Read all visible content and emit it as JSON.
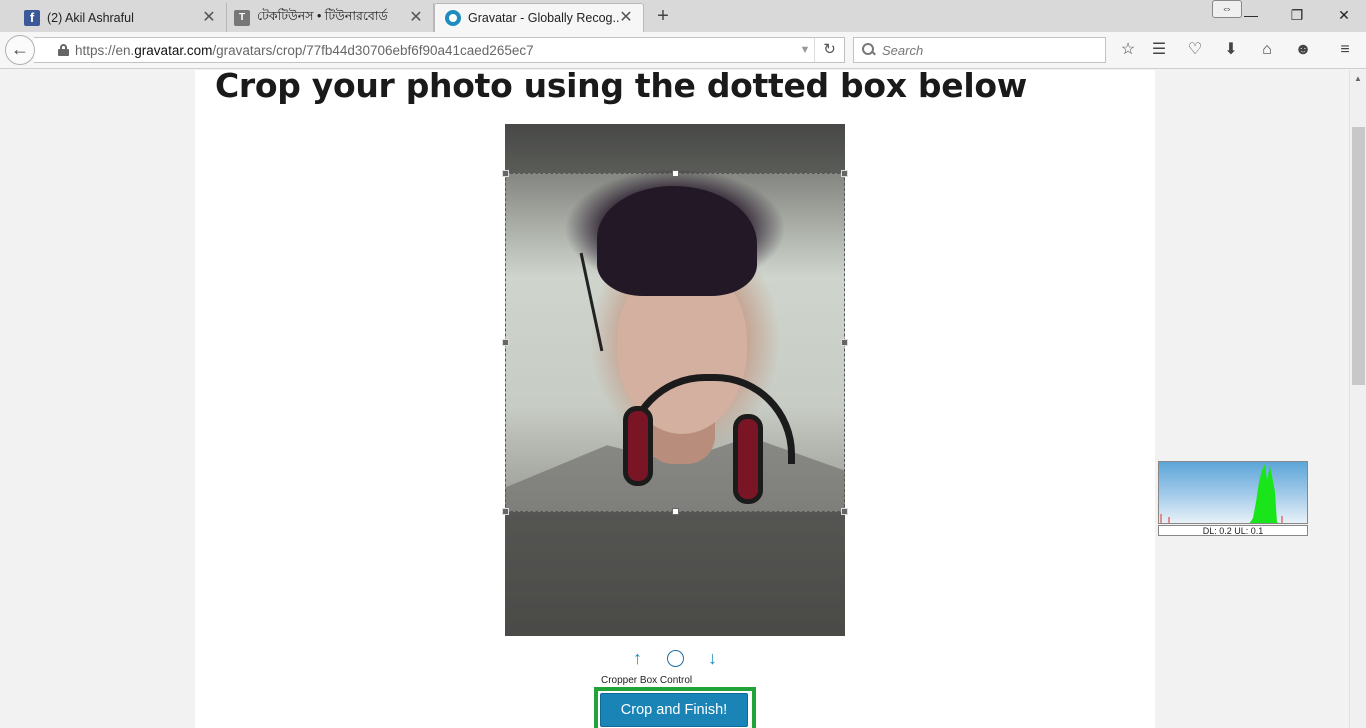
{
  "browser": {
    "tabs": [
      {
        "title": "(2) Akil Ashraful",
        "favicon": "facebook-icon"
      },
      {
        "title": "টেকটিউনস • টিউনারবোর্ড",
        "favicon": "techtunes-icon"
      },
      {
        "title": "Gravatar - Globally Recog...",
        "favicon": "gravatar-icon"
      }
    ],
    "url_prefix": "https://en.",
    "url_host": "gravatar.com",
    "url_path": "/gravatars/crop/77fb44d30706ebf6f90a41caed265ec7",
    "search_placeholder": "Search"
  },
  "page": {
    "heading": "Crop your photo using the dotted box below",
    "controls": {
      "up_glyph": "↑",
      "circle_glyph": "",
      "down_glyph": "↓",
      "label": "Cropper Box Control"
    },
    "crop_button": "Crop and Finish!",
    "accent_color": "#1a84b6",
    "highlight_color": "#22a33a"
  },
  "netmon": {
    "text": "DL: 0.2 UL: 0.1"
  }
}
